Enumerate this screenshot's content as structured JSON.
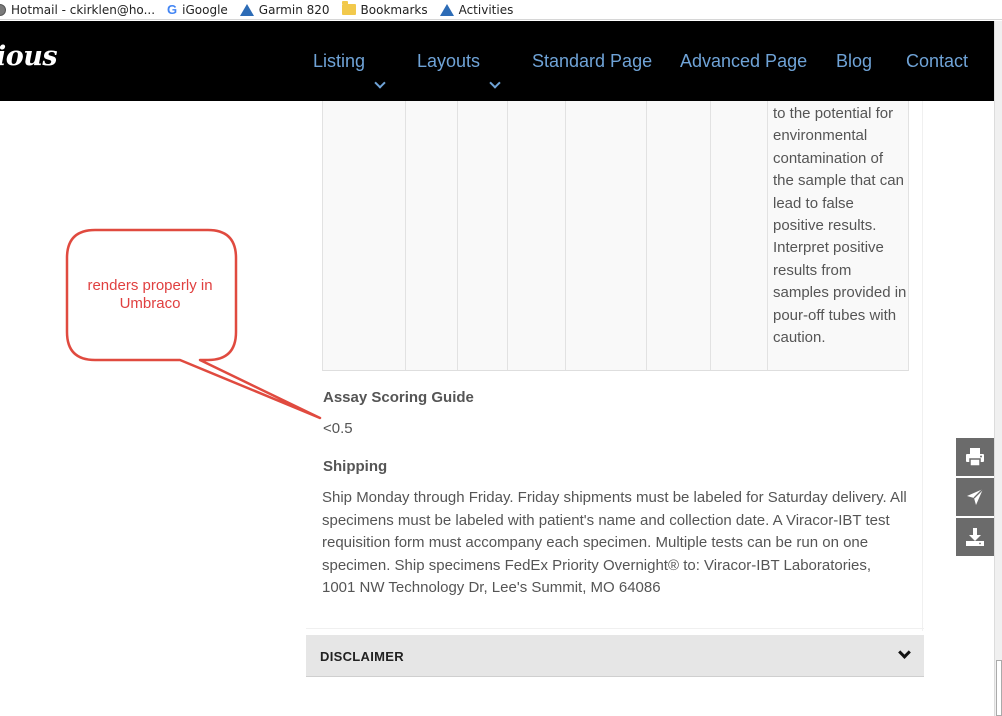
{
  "bookmarks": [
    {
      "label": "Hotmail - ckirklen@ho...",
      "icon": "globe-icon"
    },
    {
      "label": "iGoogle",
      "icon": "google-g-icon"
    },
    {
      "label": "Garmin 820",
      "icon": "garmin-triangle-icon"
    },
    {
      "label": "Bookmarks",
      "icon": "folder-icon"
    },
    {
      "label": "Activities",
      "icon": "garmin-triangle-icon"
    }
  ],
  "header": {
    "logo": "ious",
    "nav": [
      "Listing",
      "Layouts",
      "Standard Page",
      "Advanced Page",
      "Blog",
      "Contact"
    ]
  },
  "table": {
    "last_cell_text": "to the potential for environmental contamination of the sample that can lead to false positive results. Interpret positive results from samples provided in pour-off tubes with caution."
  },
  "assay": {
    "heading": "Assay Scoring Guide",
    "value": "<0.5"
  },
  "shipping": {
    "heading": "Shipping",
    "text": "Ship Monday through Friday. Friday shipments must be labeled for Saturday delivery. All specimens must be labeled with patient's name and collection date. A Viracor-IBT test requisition form must accompany each specimen. Multiple tests can be run on one specimen. Ship specimens FedEx Priority Overnight® to: Viracor-IBT Laboratories, 1001 NW Technology Dr, Lee's Summit, MO 64086"
  },
  "disclaimer": {
    "label": "DISCLAIMER"
  },
  "annotation": {
    "text": "renders properly in Umbraco",
    "color": "#e04040"
  },
  "side_actions": [
    "print-icon",
    "send-icon",
    "download-icon"
  ],
  "colors": {
    "nav_bg": "#000000",
    "nav_link": "#6fa3d7",
    "side_button": "#6b6b6b",
    "disclaimer_bg": "#e6e6e6"
  }
}
